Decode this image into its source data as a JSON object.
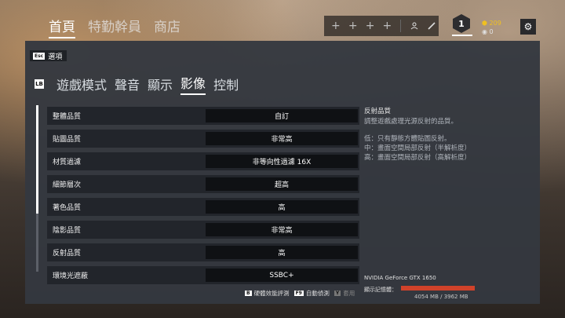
{
  "top_nav": {
    "tabs": [
      {
        "label": "首頁",
        "active": true
      },
      {
        "label": "特勤幹員",
        "active": false
      },
      {
        "label": "商店",
        "active": false
      }
    ]
  },
  "squad": {
    "slots": [
      "+",
      "+",
      "+",
      "+"
    ]
  },
  "player": {
    "level": "1",
    "renown": "209",
    "credits": "0"
  },
  "panel": {
    "back_key": "Esc",
    "back_label": "選項",
    "subnav_key": "LB",
    "tabs": [
      {
        "label": "遊戲模式",
        "active": false
      },
      {
        "label": "聲音",
        "active": false
      },
      {
        "label": "顯示",
        "active": false
      },
      {
        "label": "影像",
        "active": true
      },
      {
        "label": "控制",
        "active": false
      }
    ],
    "settings": [
      {
        "label": "整體品質",
        "value": "自訂"
      },
      {
        "label": "貼圖品質",
        "value": "非常高"
      },
      {
        "label": "材質過濾",
        "value": "非等向性過濾 16X"
      },
      {
        "label": "細節層次",
        "value": "超高"
      },
      {
        "label": "著色品質",
        "value": "高"
      },
      {
        "label": "陰影品質",
        "value": "非常高"
      },
      {
        "label": "反射品質",
        "value": "高"
      },
      {
        "label": "環境光遮蔽",
        "value": "SSBC+"
      }
    ],
    "description": {
      "title": "反射品質",
      "text": "調整遊戲處理光源反射的品質。",
      "lines": [
        "低：只有靜態方體貼圖反射。",
        "中：畫面空間局部反射（半解析度）",
        "高：畫面空間局部反射（高解析度）"
      ]
    },
    "gpu_name": "NVIDIA GeForce GTX 1650",
    "vram_label": "顯示記憶體：",
    "vram_text": "4054 MB / 3962 MB",
    "vram_usage_fraction": 1.0,
    "actions": [
      {
        "key": "B",
        "label": "硬體效能評測",
        "enabled": true
      },
      {
        "key": "F9",
        "label": "自動偵測",
        "enabled": true
      },
      {
        "key": "Y",
        "label": "套用",
        "enabled": false
      }
    ]
  }
}
